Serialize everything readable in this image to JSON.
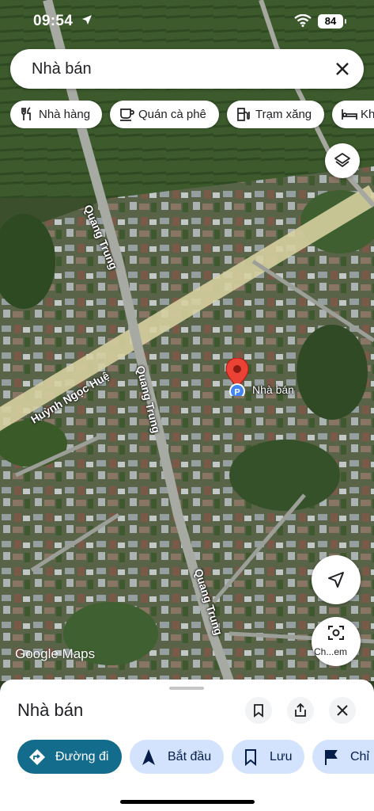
{
  "status_bar": {
    "time": "09:54",
    "battery": "84"
  },
  "search": {
    "query": "Nhà bán"
  },
  "chips": [
    {
      "label": "Nhà hàng",
      "icon": "restaurant-icon"
    },
    {
      "label": "Quán cà phê",
      "icon": "coffee-icon"
    },
    {
      "label": "Trạm xăng",
      "icon": "gas-station-icon"
    },
    {
      "label": "Kh",
      "icon": "hotel-icon"
    }
  ],
  "map": {
    "pin_label": "Nhà bán",
    "streets": {
      "huynh_ngoc_hue": "Huỳnh Ngọc Huệ",
      "quang_trung": "Quang Trung"
    },
    "watermark": "Google Maps"
  },
  "fab": {
    "lens_label": "Ch...em"
  },
  "sheet": {
    "title": "Nhà bán",
    "actions": {
      "directions": "Đường đi",
      "start": "Bắt đầu",
      "save": "Lưu",
      "share": "Chỉ"
    }
  }
}
